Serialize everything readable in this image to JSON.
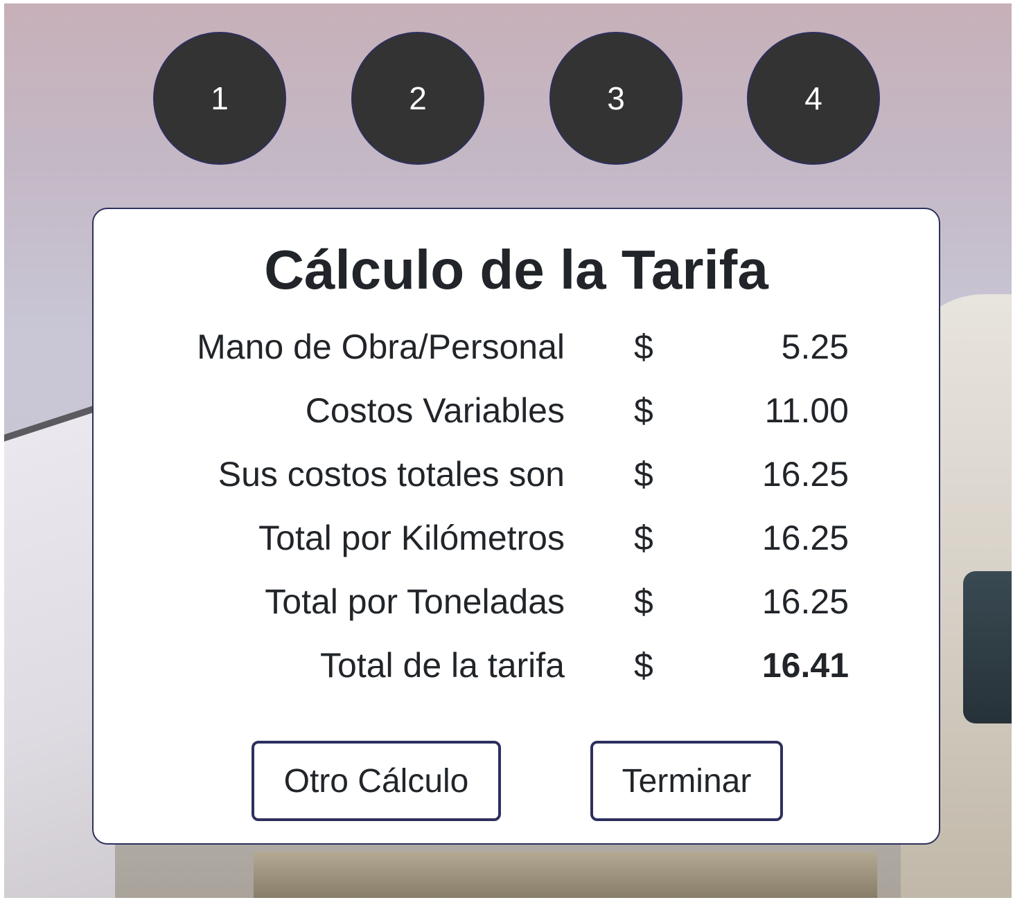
{
  "steps": [
    "1",
    "2",
    "3",
    "4"
  ],
  "card": {
    "title": "Cálculo de la Tarifa",
    "rows": [
      {
        "label": "Mano de Obra/Personal",
        "currency": "$",
        "value": "5.25"
      },
      {
        "label": "Costos Variables",
        "currency": "$",
        "value": "11.00"
      },
      {
        "label": "Sus costos totales son",
        "currency": "$",
        "value": "16.25"
      },
      {
        "label": "Total por Kilómetros",
        "currency": "$",
        "value": "16.25"
      },
      {
        "label": "Total por Toneladas",
        "currency": "$",
        "value": "16.25"
      },
      {
        "label": "Total de la tarifa",
        "currency": "$",
        "value": "16.41"
      }
    ],
    "buttons": {
      "other": "Otro Cálculo",
      "finish": "Terminar"
    }
  },
  "colors": {
    "step_bg": "#333333",
    "accent_border": "#2d2f5e",
    "text": "#212529"
  }
}
